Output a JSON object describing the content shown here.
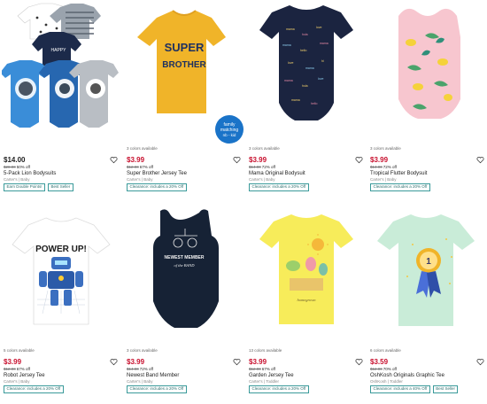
{
  "products": [
    {
      "colors": "",
      "price": "$14.00",
      "price_type": "reg",
      "was": "$28.00",
      "off": "50% off",
      "name": "5-Pack Lion Bodysuits",
      "brand": "Carter's | Baby",
      "badges": [
        "Earn Double Points!",
        "Best Seller"
      ]
    },
    {
      "colors": "3 colors available",
      "price": "$3.99",
      "price_type": "sale",
      "was": "$12.00",
      "off": "67% off",
      "name": "Super Brother Jersey Tee",
      "brand": "Carter's | Baby",
      "badges": [
        "Clearance: includes a 20% Off"
      ],
      "image_text": "SUPER BROTHER",
      "image_badge": "family matching nb - kid"
    },
    {
      "colors": "3 colors available",
      "price": "$3.99",
      "price_type": "sale",
      "was": "$14.00",
      "off": "72% off",
      "name": "Mama Original Bodysuit",
      "brand": "Carter's | Baby",
      "badges": [
        "Clearance: includes a 20% Off"
      ]
    },
    {
      "colors": "3 colors available",
      "price": "$3.99",
      "price_type": "sale",
      "was": "$14.00",
      "off": "72% off",
      "name": "Tropical Flutter Bodysuit",
      "brand": "Carter's | Baby",
      "badges": [
        "Clearance: includes a 20% Off"
      ]
    },
    {
      "colors": "5 colors available",
      "price": "$3.99",
      "price_type": "sale",
      "was": "$12.00",
      "off": "67% off",
      "name": "Robot Jersey Tee",
      "brand": "Carter's | Baby",
      "badges": [
        "Clearance: includes a 20% Off"
      ],
      "image_text": "POWER UP!"
    },
    {
      "colors": "3 colors available",
      "price": "$3.99",
      "price_type": "sale",
      "was": "$14.00",
      "off": "72% off",
      "name": "Newest Band Member",
      "brand": "Carter's | Baby",
      "badges": [
        "Clearance: includes a 20% Off"
      ],
      "image_text": "NEWEST MEMBER of the BAND"
    },
    {
      "colors": "13 colors available",
      "price": "$3.99",
      "price_type": "sale",
      "was": "$12.00",
      "off": "67% off",
      "name": "Garden Jersey Tee",
      "brand": "Carter's | Toddler",
      "badges": [
        "Clearance: includes a 20% Off"
      ]
    },
    {
      "colors": "6 colors available",
      "price": "$3.59",
      "price_type": "sale",
      "was": "$12.00",
      "off": "70% off",
      "name": "OshKosh Originals Graphic Tee",
      "brand": "OshKosh | Toddler",
      "badges": [
        "Clearance: includes a 40% Off",
        "Best Seller"
      ]
    }
  ],
  "icons": {
    "favorite": "heart-outline-icon"
  },
  "colors_theme": {
    "sale_price": "#c8102e",
    "badge_border": "#3a9a9a"
  }
}
